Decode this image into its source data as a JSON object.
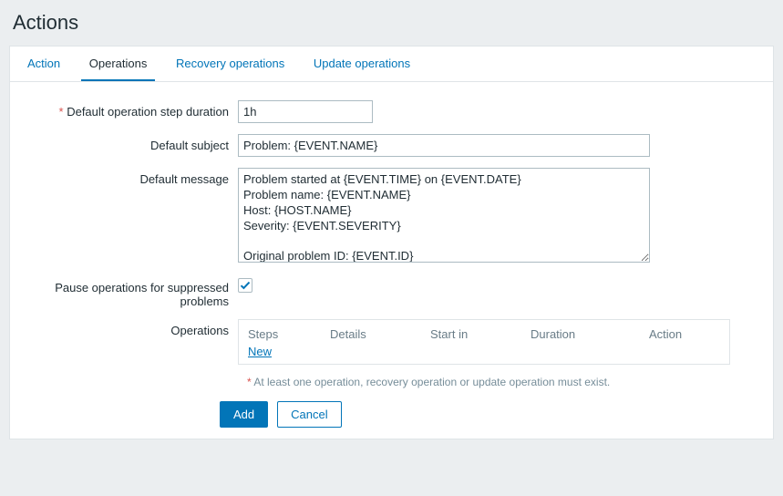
{
  "page": {
    "title": "Actions"
  },
  "tabs": {
    "action": "Action",
    "operations": "Operations",
    "recovery": "Recovery operations",
    "update": "Update operations"
  },
  "labels": {
    "stepDuration": "Default operation step duration",
    "subject": "Default subject",
    "message": "Default message",
    "pause": "Pause operations for suppressed problems",
    "operations": "Operations"
  },
  "values": {
    "stepDuration": "1h",
    "subject": "Problem: {EVENT.NAME}",
    "message": "Problem started at {EVENT.TIME} on {EVENT.DATE}\nProblem name: {EVENT.NAME}\nHost: {HOST.NAME}\nSeverity: {EVENT.SEVERITY}\n\nOriginal problem ID: {EVENT.ID}\n{TRIGGER.URL}"
  },
  "opsTable": {
    "cols": {
      "steps": "Steps",
      "details": "Details",
      "startIn": "Start in",
      "duration": "Duration",
      "action": "Action"
    },
    "newLink": "New"
  },
  "hint": {
    "star": "*",
    "text": "At least one operation, recovery operation or update operation must exist."
  },
  "buttons": {
    "add": "Add",
    "cancel": "Cancel"
  }
}
